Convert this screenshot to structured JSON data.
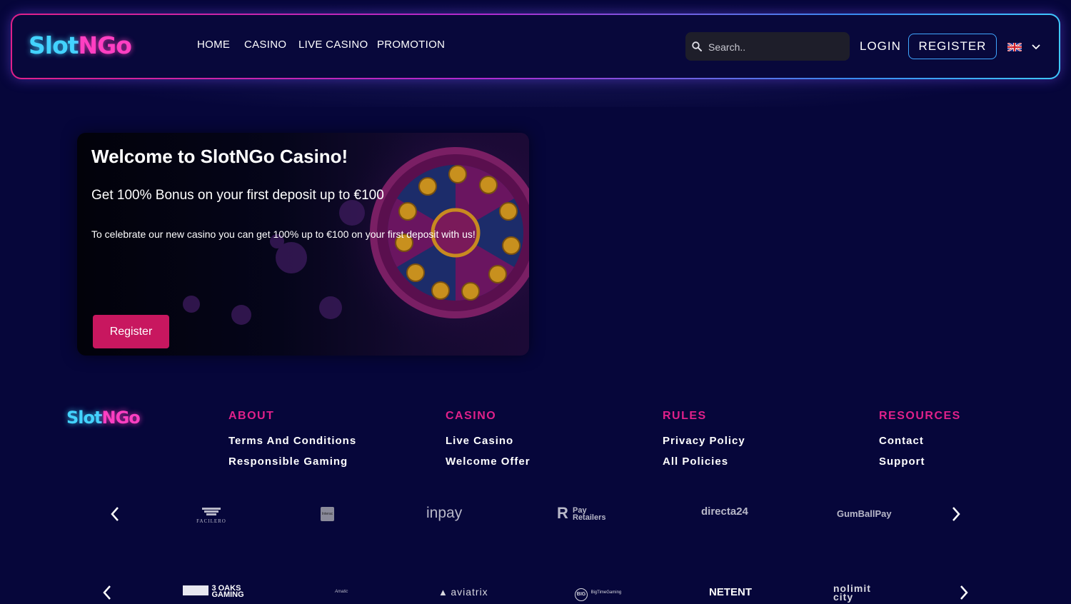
{
  "brand": {
    "part1": "Slot",
    "part2": "NGo"
  },
  "nav": {
    "items": [
      "HOME",
      "CASINO",
      "LIVE CASINO",
      "PROMOTION"
    ]
  },
  "header": {
    "search_placeholder": "Search..",
    "login_label": "LOGIN",
    "register_label": "REGISTER",
    "language": "English (UK flag)"
  },
  "banner": {
    "title": "Welcome to SlotNGo Casino!",
    "subtitle": "Get 100% Bonus on your first deposit up to €100",
    "text": "To celebrate our new casino you can get 100% up to €100 on your first deposit with us!",
    "button_label": "Register"
  },
  "footer": {
    "columns": [
      {
        "heading": "ABOUT",
        "links": [
          "Terms And Conditions",
          "Responsible Gaming"
        ]
      },
      {
        "heading": "CASINO",
        "links": [
          "Live Casino",
          "Welcome Offer"
        ]
      },
      {
        "heading": "RULES",
        "links": [
          "Privacy Policy",
          "All Policies"
        ]
      },
      {
        "heading": "RESOURCES",
        "links": [
          "Contact",
          "Support"
        ]
      }
    ]
  },
  "payment_logos": [
    "FACILERO",
    "Interac",
    "inpay",
    "Pay Retailers",
    "directa24",
    "GumBallPay"
  ],
  "provider_logos": [
    "3 OAKS GAMING",
    "Amatic",
    "aviatrix",
    "BigTimeGaming",
    "NETENT",
    "nolimit city"
  ],
  "colors": {
    "background": "#06063a",
    "accent_pink": "#e0208a",
    "button": "#c8175f",
    "logo_cyan": "#43d3ff"
  }
}
